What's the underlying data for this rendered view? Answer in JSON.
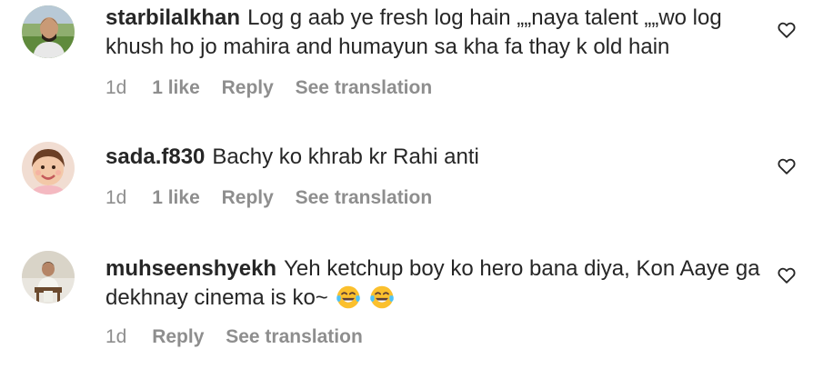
{
  "comments": [
    {
      "username": "starbilalkhan",
      "text": "Log g aab ye fresh log hain „„naya talent „„wo log khush ho jo mahira and humayun sa kha fa thay k old hain",
      "time": "1d",
      "likes": "1 like",
      "reply": "Reply",
      "translate": "See translation"
    },
    {
      "username": "sada.f830",
      "text": "Bachy ko khrab kr Rahi anti",
      "time": "1d",
      "likes": "1 like",
      "reply": "Reply",
      "translate": "See translation"
    },
    {
      "username": "muhseenshyekh",
      "text": "Yeh ketchup boy ko hero bana diya, Kon Aaye ga dekhnay cinema is ko~",
      "emojis": [
        "face-with-tears-of-joy",
        "face-with-tears-of-joy"
      ],
      "time": "1d",
      "reply": "Reply",
      "translate": "See translation"
    }
  ],
  "colors": {
    "text": "#262626",
    "meta": "#8e8e8e"
  }
}
